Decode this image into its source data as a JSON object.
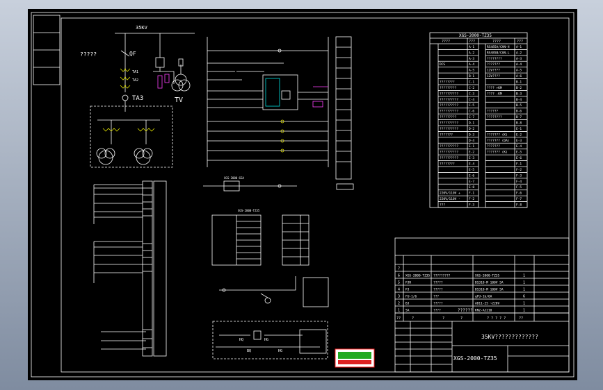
{
  "diagram": {
    "bus_label": "35KV",
    "left_note": "?????",
    "breaker_label": "QF",
    "ct_label": "TA3",
    "vt_label": "TV",
    "table_title": "XGS-2000-TZ35",
    "table_header": [
      "????",
      "???",
      "????",
      "???"
    ],
    "table_rows_left": [
      {
        "text": "",
        "code": "A-1"
      },
      {
        "text": "",
        "code": "A-2"
      },
      {
        "text": "",
        "code": "A-3"
      },
      {
        "text": "DCS",
        "code": "A-4"
      },
      {
        "text": "",
        "code": "A-5"
      },
      {
        "text": "",
        "code": "B-1"
      },
      {
        "text": "????????",
        "code": "C-1"
      },
      {
        "text": "?????????",
        "code": "C-2"
      },
      {
        "text": "??????????",
        "code": "C-3"
      },
      {
        "text": "??????????",
        "code": "C-4"
      },
      {
        "text": "??????????",
        "code": "C-5"
      },
      {
        "text": "??????????",
        "code": "C-6"
      },
      {
        "text": "?????????",
        "code": "C-7"
      },
      {
        "text": "??????????",
        "code": "D-1"
      },
      {
        "text": "??????????",
        "code": "D-2"
      },
      {
        "text": "???????",
        "code": "D-3"
      },
      {
        "text": "",
        "code": "D-4"
      },
      {
        "text": "??????????",
        "code": "E-1"
      },
      {
        "text": "??????????",
        "code": "E-2"
      },
      {
        "text": "??????????",
        "code": "E-3"
      },
      {
        "text": "????????",
        "code": "E-4"
      },
      {
        "text": "",
        "code": "E-5"
      },
      {
        "text": "",
        "code": "E-6"
      },
      {
        "text": "",
        "code": "E-7"
      },
      {
        "text": "",
        "code": "E-8"
      },
      {
        "text": "220V/110V +",
        "code": "F-1"
      },
      {
        "text": "220V/110V -",
        "code": "F-2"
      },
      {
        "text": "???",
        "code": "F-3"
      }
    ],
    "table_rows_right": [
      {
        "text": "RS485A/CAN-H",
        "code": "A-1"
      },
      {
        "text": "RS485B/CAN-L",
        "code": "A-2"
      },
      {
        "text": "????????",
        "code": "A-3"
      },
      {
        "text": "???????",
        "code": "A-4"
      },
      {
        "text": "12V????",
        "code": "A-5"
      },
      {
        "text": "12V????",
        "code": "A-6"
      },
      {
        "text": "",
        "code": "B-1"
      },
      {
        "text": "???? +KM",
        "code": "B-2"
      },
      {
        "text": "???? -KM",
        "code": "B-3"
      },
      {
        "text": "",
        "code": "B-4"
      },
      {
        "text": "",
        "code": "B-5"
      },
      {
        "text": "??????",
        "code": "B-6"
      },
      {
        "text": "????????",
        "code": "B-7"
      },
      {
        "text": "",
        "code": "B-8"
      },
      {
        "text": "",
        "code": "E-1"
      },
      {
        "text": "??????? (K)",
        "code": "E-2"
      },
      {
        "text": "??????? (DA)",
        "code": "E-3"
      },
      {
        "text": "???????",
        "code": "E-4"
      },
      {
        "text": "??????? (K)",
        "code": "E-5"
      },
      {
        "text": "",
        "code": "E-6"
      },
      {
        "text": "",
        "code": "F-1"
      },
      {
        "text": "",
        "code": "F-2"
      },
      {
        "text": "",
        "code": "F-3"
      },
      {
        "text": "",
        "code": "F-4"
      },
      {
        "text": "",
        "code": "F-5"
      },
      {
        "text": "",
        "code": "F-6"
      },
      {
        "text": "",
        "code": "F-7"
      },
      {
        "text": "",
        "code": "F-8"
      }
    ],
    "bom_rows": [
      {
        "no": "7",
        "code": "",
        "name": "",
        "model": "",
        "qty": ""
      },
      {
        "no": "6",
        "code": "XGS-2000-TZ35",
        "name": "?????????",
        "model": "XGS-2000-TZ35",
        "qty": "1"
      },
      {
        "no": "5",
        "code": "PJR",
        "name": "?????",
        "model": "DS318-M 100V 5A",
        "qty": "1"
      },
      {
        "no": "4",
        "code": "PJ",
        "name": "?????",
        "model": "DS318-M 100V 5A",
        "qty": "1"
      },
      {
        "no": "3",
        "code": "FU-1/6",
        "name": "???",
        "model": "gFU-1b/6A",
        "qty": "6"
      },
      {
        "no": "2",
        "code": "BJ",
        "name": "?????",
        "model": "AD11-25 ~220V",
        "qty": "1"
      },
      {
        "no": "1",
        "code": "SA",
        "name": "????",
        "model": "KN2-AJ210",
        "qty": "1"
      }
    ],
    "bom_header": [
      "??",
      "?",
      "?",
      "?",
      "? ? ? ? ?",
      "??"
    ],
    "bom_caption": "??????",
    "title_main": "35KV?????????????",
    "drawing_no": "XGS-2000-TZ35",
    "sub_box_title": "XGS-2000-TZ35",
    "remote_box_label": "XGS-2000-GSA",
    "relay_labels": [
      "HQ",
      "HG",
      "BQ",
      "HG"
    ],
    "side_marks": [
      "S1",
      "S2",
      "S3",
      "S4",
      "S5",
      "S6"
    ]
  },
  "colors": {
    "background": "#000000",
    "frame": "#ffffff",
    "cyan": "#00e0e0",
    "magenta": "#ff40ff",
    "yellow": "#e0e000"
  }
}
